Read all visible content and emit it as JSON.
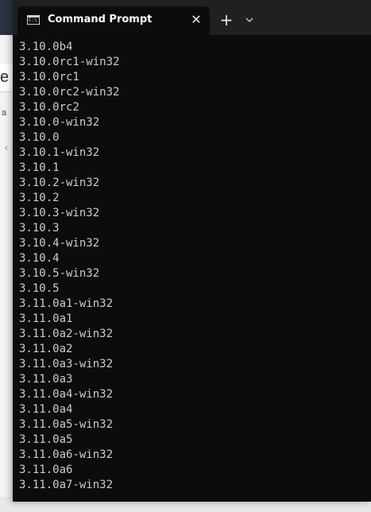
{
  "background_app": {
    "heading_fragment": "e",
    "text_fragment": "a",
    "chevron_icon": "chevron-left-icon"
  },
  "window": {
    "tab_title": "Command Prompt",
    "tab_icon": "command-prompt-icon",
    "tab_icon_text": "C:\\",
    "close_icon": "close-icon",
    "new_tab_icon": "plus-icon",
    "dropdown_icon": "chevron-down-icon"
  },
  "colors": {
    "terminal_bg": "#0c0c0c",
    "titlebar_bg": "#202020",
    "text": "#cccccc"
  },
  "console": {
    "lines": [
      "3.10.0b4",
      "3.10.0rc1-win32",
      "3.10.0rc1",
      "3.10.0rc2-win32",
      "3.10.0rc2",
      "3.10.0-win32",
      "3.10.0",
      "3.10.1-win32",
      "3.10.1",
      "3.10.2-win32",
      "3.10.2",
      "3.10.3-win32",
      "3.10.3",
      "3.10.4-win32",
      "3.10.4",
      "3.10.5-win32",
      "3.10.5",
      "3.11.0a1-win32",
      "3.11.0a1",
      "3.11.0a2-win32",
      "3.11.0a2",
      "3.11.0a3-win32",
      "3.11.0a3",
      "3.11.0a4-win32",
      "3.11.0a4",
      "3.11.0a5-win32",
      "3.11.0a5",
      "3.11.0a6-win32",
      "3.11.0a6",
      "3.11.0a7-win32"
    ]
  }
}
